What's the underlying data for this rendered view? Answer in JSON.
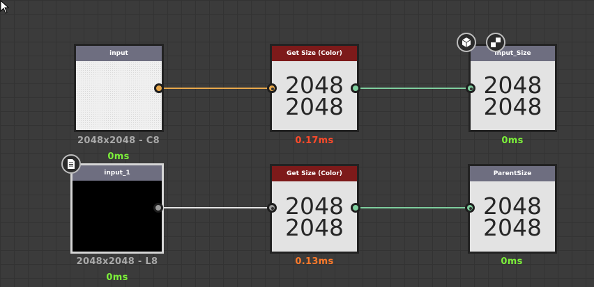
{
  "colors": {
    "color_wire": "#e8a84b",
    "value_wire": "#7fcf9f",
    "gray_wire": "#e6e6e6",
    "title_input": "#6e6e80",
    "title_getsize": "#7d1a1a",
    "time_green": "#7cf03a",
    "time_red": "#ff4a2a",
    "time_orange": "#ff7a2a",
    "caption_gray": "#a9a9a9"
  },
  "nodes": {
    "input": {
      "title": "input",
      "caption": "2048x2048 - C8",
      "time": "0ms"
    },
    "get_size_1": {
      "title": "Get Size (Color)",
      "width": "2048",
      "height": "2048",
      "time": "0.17ms"
    },
    "input_size": {
      "title": "Input_Size",
      "width": "2048",
      "height": "2048",
      "time": "0ms"
    },
    "input_1": {
      "title": "input_1",
      "caption": "2048x2048 - L8",
      "time": "0ms"
    },
    "get_size_2": {
      "title": "Get Size (Color)",
      "width": "2048",
      "height": "2048",
      "time": "0.13ms"
    },
    "parent_size": {
      "title": "ParentSize",
      "width": "2048",
      "height": "2048",
      "time": "0ms"
    }
  },
  "icons": {
    "badge_3d": "cube-icon",
    "badge_tile": "checker-icon",
    "badge_doc": "document-icon",
    "cursor": "mouse-pointer-icon"
  }
}
